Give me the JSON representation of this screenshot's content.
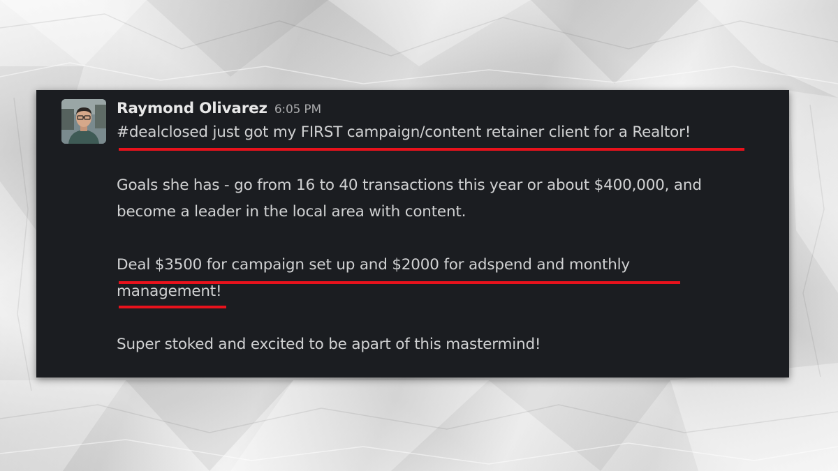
{
  "message": {
    "author": "Raymond Olivarez",
    "time": "6:05 PM",
    "lines": {
      "line1": "#dealclosed just got my FIRST campaign/content retainer client for a Realtor!",
      "line2": "Goals she has - go from 16 to 40 transactions this year or about $400,000, and",
      "line3": "become a leader in the local area with content.",
      "line4": "Deal $3500 for campaign set up and $2000 for adspend and monthly",
      "line5": "management!",
      "line6": "Super stoked and excited to be apart of this mastermind!"
    }
  },
  "colors": {
    "card_background": "#1b1d21",
    "message_text": "#d1d2d3",
    "underline": "#e8121c"
  }
}
